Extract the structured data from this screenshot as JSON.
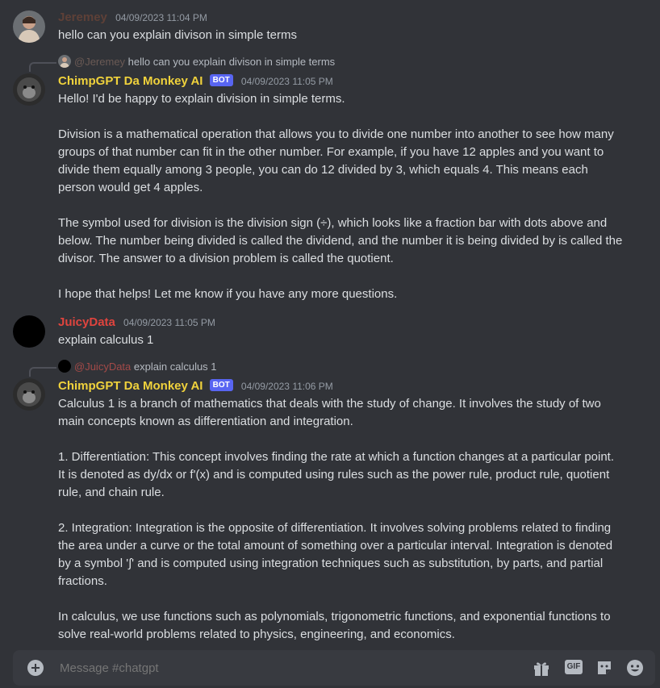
{
  "channel": "chatgpt",
  "messages": [
    {
      "author": "Jeremey",
      "author_color": "#5e4037",
      "timestamp": "04/09/2023 11:04 PM",
      "text": "hello can you explain divison in simple terms"
    },
    {
      "reply_to_author": "@Jeremey",
      "reply_to_text": "hello can you explain divison in simple terms",
      "author": "ChimpGPT Da Monkey AI",
      "author_color": "#f0d23c",
      "bot_tag": "BOT",
      "timestamp": "04/09/2023 11:05 PM",
      "text": "Hello! I'd be happy to explain division in simple terms.\n\nDivision is a mathematical operation that allows you to divide one number into another to see how many groups of that number can fit in the other number. For example, if you have 12 apples and you want to divide them equally among 3 people, you can do 12 divided by 3, which equals 4. This means each person would get 4 apples.\n\nThe symbol used for division is the division sign (÷), which looks like a fraction bar with dots above and below. The number being divided is called the dividend, and the number it is being divided by is called the divisor. The answer to a division problem is called the quotient.\n\nI hope that helps! Let me know if you have any more questions."
    },
    {
      "author": "JuicyData",
      "author_color": "#e0443e",
      "timestamp": "04/09/2023 11:05 PM",
      "text": "explain calculus 1"
    },
    {
      "reply_to_author": "@JuicyData",
      "reply_to_text": "explain calculus 1",
      "author": "ChimpGPT Da Monkey AI",
      "author_color": "#f0d23c",
      "bot_tag": "BOT",
      "timestamp": "04/09/2023 11:06 PM",
      "text": "Calculus 1 is a branch of mathematics that deals with the study of change. It involves the study of two main concepts known as differentiation and integration.\n\n1. Differentiation: This concept involves finding the rate at which a function changes at a particular point. It is denoted as dy/dx or f'(x) and is computed using rules such as the power rule, product rule, quotient rule, and chain rule.\n\n2. Integration: Integration is the opposite of differentiation. It involves solving problems related to finding the area under a curve or the total amount of something over a particular interval. Integration is denoted by a symbol '∫' and is computed using integration techniques such as substitution, by parts, and partial fractions.\n\nIn calculus, we use functions such as polynomials, trigonometric functions, and exponential functions to solve real-world problems related to physics, engineering, and economics."
    }
  ],
  "composer": {
    "placeholder": "Message #chatgpt",
    "gif_label": "GIF",
    "icons": [
      "plus-icon",
      "gift-icon",
      "gif-icon",
      "sticker-icon",
      "emoji-icon"
    ]
  }
}
